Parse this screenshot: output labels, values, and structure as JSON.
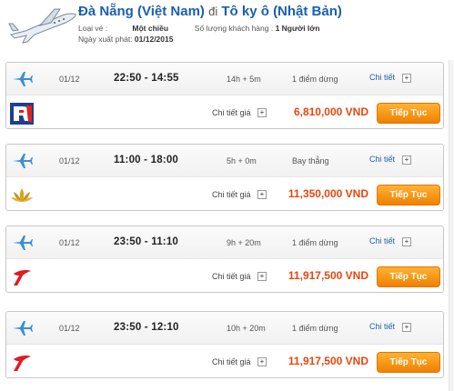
{
  "header": {
    "origin": "Đà Nẵng (Việt Nam)",
    "connector": "đi",
    "destination": "Tô ky ô (Nhật Bản)",
    "ticket_type_label": "Loại vé :",
    "ticket_type_value": "Một chiều",
    "passengers_label": "Số lượng khách hàng :",
    "passengers_value": "1 Người lớn",
    "export_date_label": "Ngày xuất phát:",
    "export_date_value": "01/12/2015"
  },
  "flights": [
    {
      "date": "01/12",
      "time": "22:50 - 14:55",
      "duration": "14h + 5m",
      "stops": "1 điểm dừng",
      "detail_label": "Chi tiết",
      "price_detail_label": "Chi tiết giá",
      "price": "6,810,000 VND",
      "book_label": "Tiếp Tục",
      "airline_logo": "airline-logo-red-blue"
    },
    {
      "date": "01/12",
      "time": "11:00 - 18:00",
      "duration": "5h + 0m",
      "stops": "Bay thẳng",
      "detail_label": "Chi tiết",
      "price_detail_label": "Chi tiết giá",
      "price": "11,350,000 VND",
      "book_label": "Tiếp Tục",
      "airline_logo": "lotus-logo"
    },
    {
      "date": "01/12",
      "time": "23:50 - 11:10",
      "duration": "9h + 20m",
      "stops": "1 điểm dừng",
      "detail_label": "Chi tiết",
      "price_detail_label": "Chi tiết giá",
      "price": "11,917,500 VND",
      "book_label": "Tiếp Tục",
      "airline_logo": "red-swoosh-logo"
    },
    {
      "date": "01/12",
      "time": "23:50 - 12:10",
      "duration": "10h + 20m",
      "stops": "1 điểm dừng",
      "detail_label": "Chi tiết",
      "price_detail_label": "Chi tiết giá",
      "price": "11,917,500 VND",
      "book_label": "Tiếp Tục",
      "airline_logo": "red-swoosh-logo"
    }
  ],
  "plus_symbol": "+",
  "colors": {
    "title": "#1b5fae",
    "price": "#e8460e",
    "button": "#f08000"
  }
}
